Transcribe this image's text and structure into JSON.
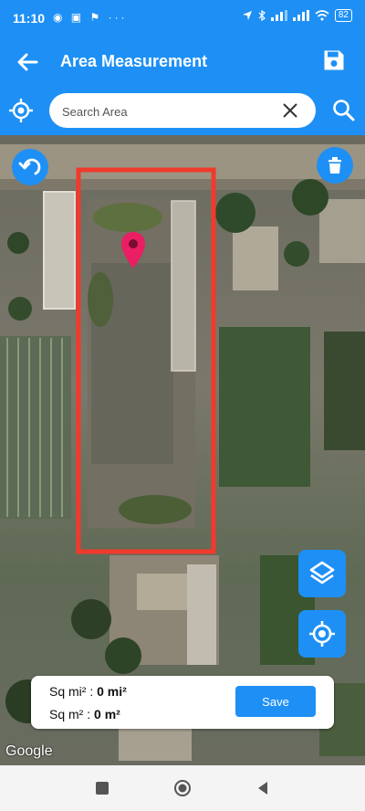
{
  "status": {
    "time": "11:10",
    "left_icons": "◉ ▣ ⚑ ···",
    "battery": "82"
  },
  "app": {
    "title": "Area Measurement"
  },
  "search": {
    "placeholder": "Search Area",
    "value": ""
  },
  "info": {
    "sq_mi_label": "Sq mi² :",
    "sq_mi_value": "0 mi²",
    "sq_m_label": "Sq m² :",
    "sq_m_value": "0 m²",
    "save_label": "Save"
  },
  "map": {
    "attribution": "Google"
  },
  "colors": {
    "primary": "#1E90F5",
    "outline": "#F03A2C",
    "pin": "#E91E63"
  },
  "icons": [
    "back-arrow-icon",
    "save-disk-icon",
    "crosshair-icon",
    "clear-icon",
    "search-icon",
    "undo-icon",
    "trash-icon",
    "layers-icon",
    "my-location-icon",
    "map-pin-icon",
    "nav-recents-icon",
    "nav-home-icon",
    "nav-back-icon"
  ]
}
